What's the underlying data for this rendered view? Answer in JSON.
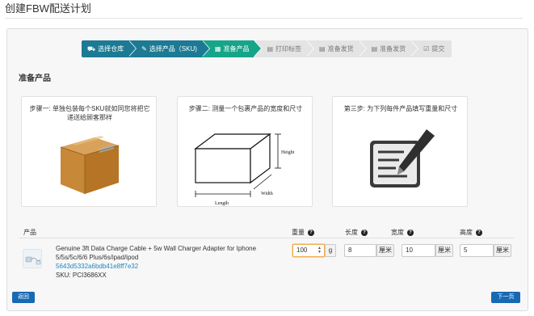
{
  "page": {
    "title": "创建FBW配送计划"
  },
  "steps": [
    {
      "label": "选择仓库",
      "icon": "truck-icon",
      "state": "done"
    },
    {
      "label": "选择产品（SKU)",
      "icon": "tag-icon",
      "state": "done"
    },
    {
      "label": "准备产品",
      "icon": "grid-icon",
      "state": "active"
    },
    {
      "label": "打印标签",
      "icon": "printer-icon",
      "state": "todo"
    },
    {
      "label": "准备发货",
      "icon": "list-icon",
      "state": "todo"
    },
    {
      "label": "准备发货",
      "icon": "list-icon",
      "state": "todo"
    },
    {
      "label": "提交",
      "icon": "check-icon",
      "state": "todo"
    }
  ],
  "section": {
    "title": "准备产品"
  },
  "cards": [
    {
      "caption": "步骤一: 单独包装每个SKU就如同您将把它递送给顾客那样"
    },
    {
      "caption": "步骤二: 测量一个包裹产品的宽度和尺寸",
      "diagram_labels": {
        "height": "Height",
        "length": "Length",
        "width": "Width"
      }
    },
    {
      "caption": "第三步:  为下列每件产品填写重量和尺寸"
    }
  ],
  "table": {
    "headers": {
      "product": "产品",
      "weight": "重量",
      "length": "长度",
      "width": "宽度",
      "height": "高度"
    },
    "rows": [
      {
        "name": "Genuine 3ft Data Charge Cable + 5w Wall Charger Adapter for Iphone 5/5s/5c/6/6 Plus/6s/ipad/ipod",
        "id": "5643d5332a6bdb41e8ff7e32",
        "sku": "SKU: PCI3686XX",
        "weight": "100",
        "weight_unit": "g",
        "length": "8",
        "width": "10",
        "height": "5",
        "dim_unit": "厘米"
      }
    ]
  },
  "buttons": {
    "back": "返回",
    "next": "下一页"
  },
  "colors": {
    "step_done": "#1c7a94",
    "step_active": "#17a589",
    "step_todo": "#e4e4e4",
    "primary_button": "#1769b3",
    "link": "#1f86c2"
  }
}
